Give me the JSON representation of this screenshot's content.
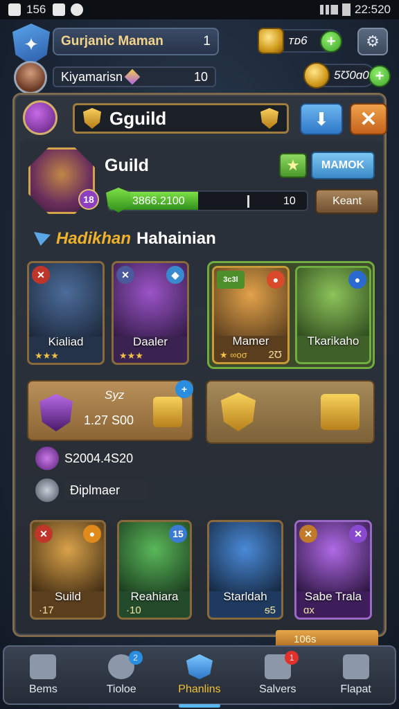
{
  "status_bar": {
    "left_text": "156",
    "time": "22:520"
  },
  "player": {
    "name": "Gurjanic Maman",
    "level": "1",
    "subname": "Kiyamarisn",
    "sub_value": "10"
  },
  "resources": [
    {
      "value": "ᴛᴅ6",
      "icon": "gold-shield-icon"
    },
    {
      "value": "5Ʊ0ɑ0",
      "icon": "gold-coin-icon"
    }
  ],
  "guild": {
    "title": "Gguild",
    "name": "Guild",
    "emblem_badge": "18",
    "action_label": "MAMOK",
    "xp_text": "3866.2100",
    "xp_fraction": 0.45,
    "xp_right": "10",
    "manage_label": "Keant",
    "section": {
      "gold": "Hadikhan",
      "white": "Hahainian"
    }
  },
  "heroes_top": [
    {
      "name": "Kialiad",
      "stars": "★★★"
    },
    {
      "name": "Daaler",
      "stars": "★★★"
    },
    {
      "name": "Mamer",
      "stars": "★ ∞oσ",
      "sub": "2Ʊ",
      "badge": "3c3l"
    },
    {
      "name": "Tkarikaho",
      "stars": ""
    }
  ],
  "rewards": {
    "title": "Syz",
    "amount": "1.27 S00",
    "row1": "S2004.4S20",
    "row2": "Ɖiplmaer"
  },
  "heroes_bottom": [
    {
      "name": "Suild",
      "sub": "·17"
    },
    {
      "name": "Reahiara",
      "sub": "·10",
      "badge": "15"
    },
    {
      "name": "Starldah",
      "sub": "ᵴ5"
    },
    {
      "name": "Sabe Trala",
      "sub": "ɑx"
    }
  ],
  "float_tag": "106s",
  "nav": [
    {
      "label": "Bems",
      "icon": "home-icon"
    },
    {
      "label": "Tioloe",
      "icon": "people-icon",
      "badge": "2"
    },
    {
      "label": "Phanlins",
      "icon": "crystal-icon",
      "active": true
    },
    {
      "label": "Salvers",
      "icon": "mail-icon",
      "badge": "1"
    },
    {
      "label": "Flapat",
      "icon": "bag-icon"
    }
  ]
}
